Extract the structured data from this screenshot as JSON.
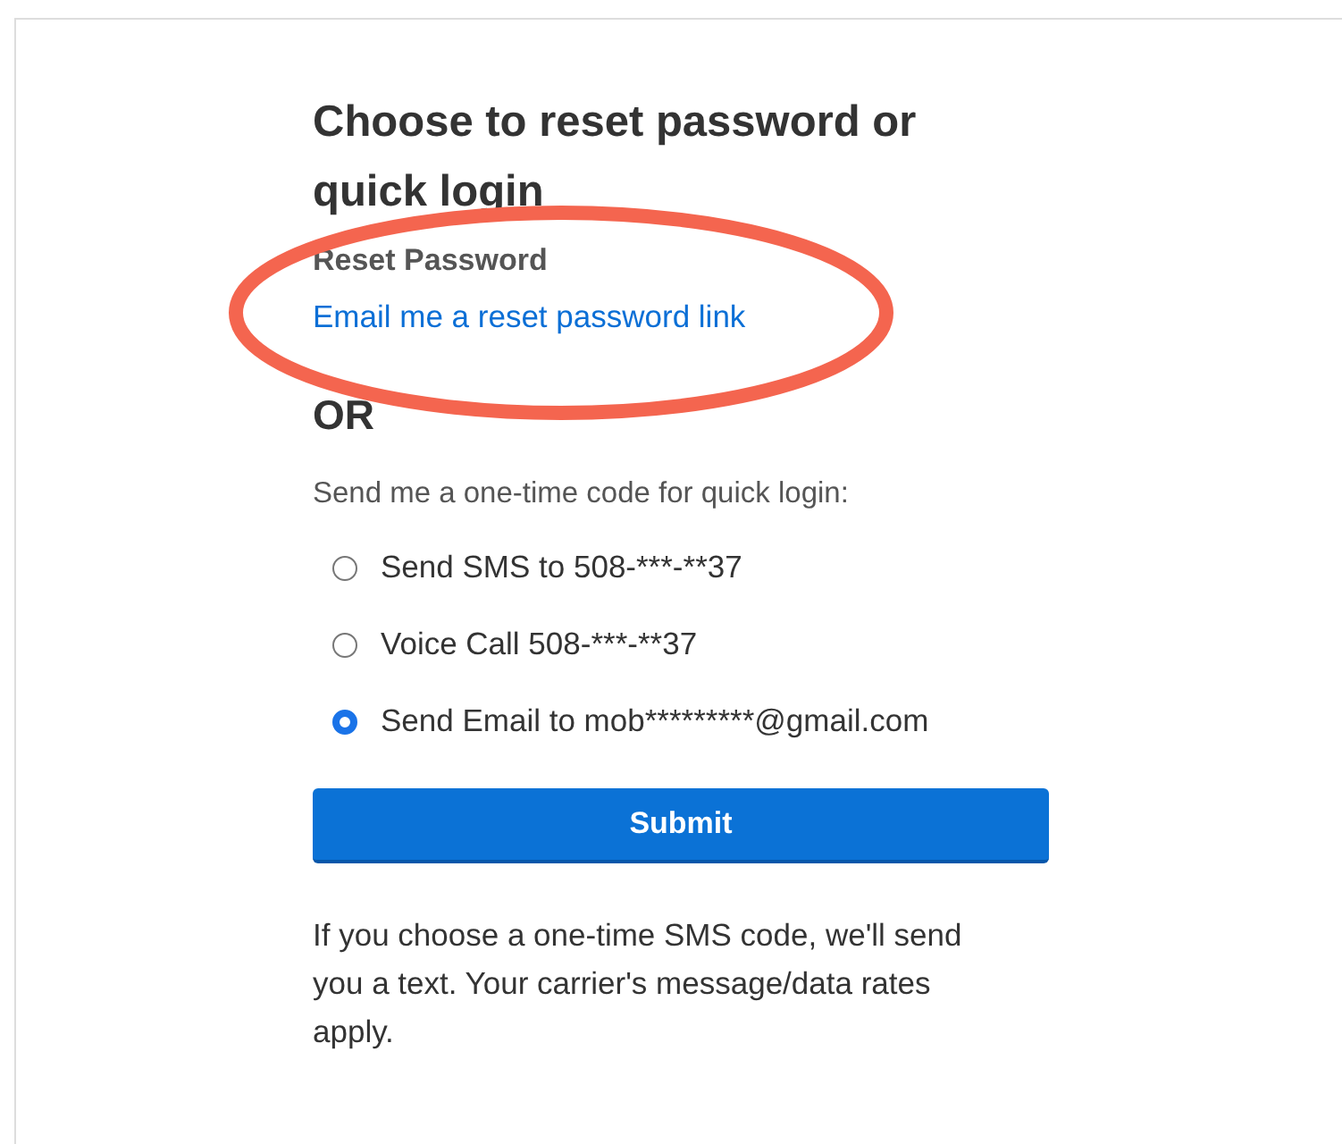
{
  "heading": "Choose to reset password or quick login",
  "reset": {
    "label": "Reset Password",
    "link": "Email me a reset password link"
  },
  "separator": "OR",
  "quick_login": {
    "prompt": "Send me a one-time code for quick login:",
    "options": [
      {
        "label": "Send SMS to 508-***-**37",
        "selected": false
      },
      {
        "label": "Voice Call 508-***-**37",
        "selected": false
      },
      {
        "label": "Send Email to mob*********@gmail.com",
        "selected": true
      }
    ]
  },
  "submit": "Submit",
  "note": "If you choose a one-time SMS code, we'll send you a text. Your carrier's message/data rates apply.",
  "annotations": [
    {
      "kind": "ellipse"
    }
  ]
}
